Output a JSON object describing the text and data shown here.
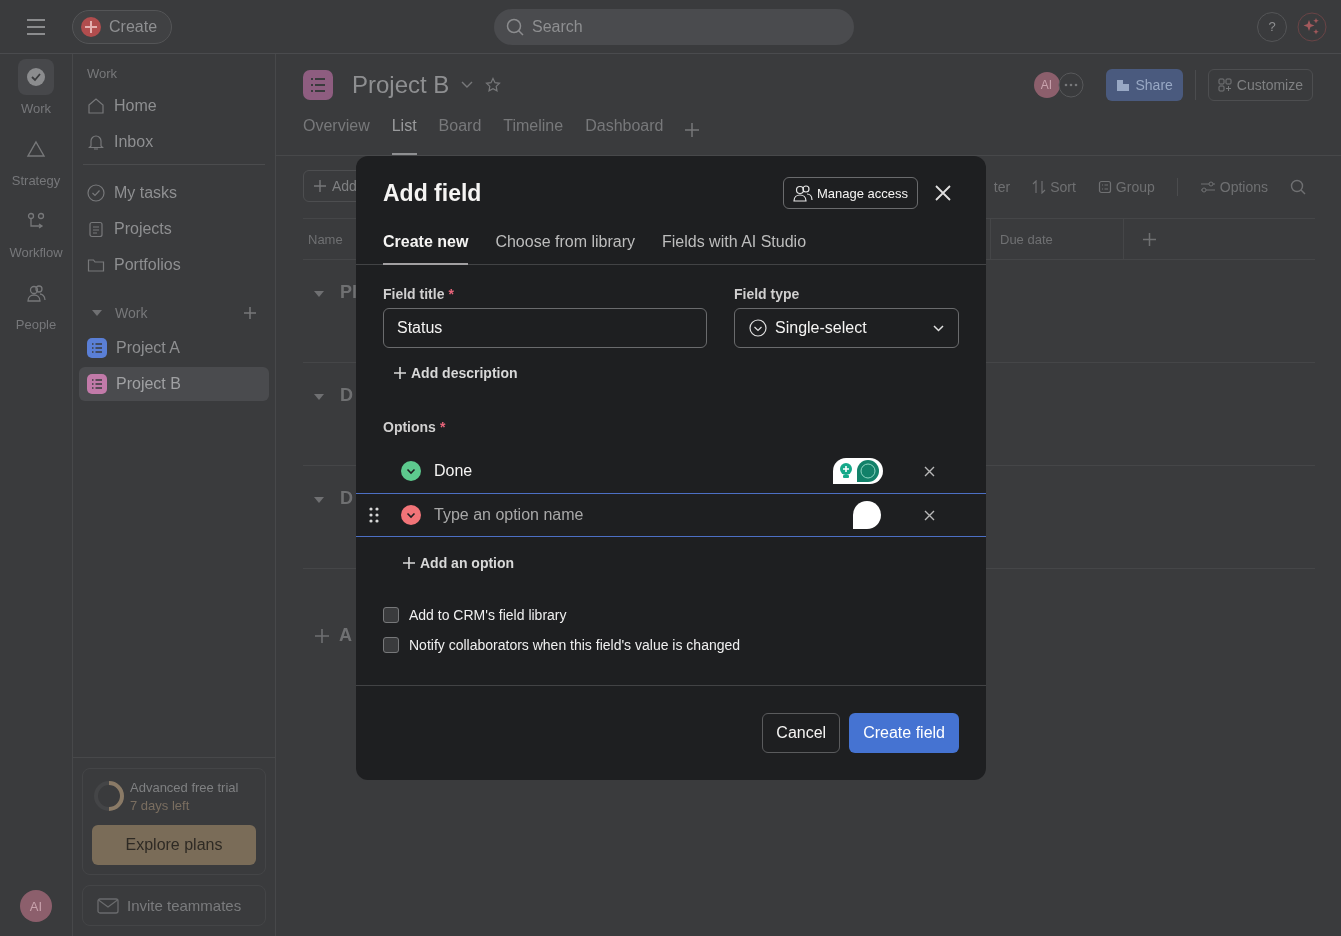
{
  "top_bar": {
    "create_label": "Create",
    "search": {
      "placeholder": "Search"
    },
    "help": "?"
  },
  "rail": [
    {
      "label": "Work",
      "selected": true
    },
    {
      "label": "Strategy",
      "selected": false
    },
    {
      "label": "Workflow",
      "selected": false
    },
    {
      "label": "People",
      "selected": false
    }
  ],
  "user_avatar": "AI",
  "sidebar": {
    "section_label": "Work",
    "nav": [
      {
        "label": "Home"
      },
      {
        "label": "Inbox"
      }
    ],
    "nav2": [
      {
        "label": "My tasks"
      },
      {
        "label": "Projects"
      },
      {
        "label": "Portfolios"
      }
    ],
    "team": {
      "label": "Work",
      "expanded": true,
      "projects": [
        {
          "label": "Project A",
          "color": "#5a7fd6",
          "selected": false
        },
        {
          "label": "Project B",
          "color": "#c27aa9",
          "selected": true
        }
      ]
    },
    "trial": {
      "title": "Advanced free trial",
      "subtitle": "7 days left",
      "level": 0.5,
      "button": "Explore plans"
    },
    "invite": "Invite teammates"
  },
  "project": {
    "title": "Project B",
    "avatar": "AI",
    "share": "Share",
    "customize": "Customize",
    "tabs": [
      {
        "label": "Overview",
        "selected": false
      },
      {
        "label": "List",
        "selected": true
      },
      {
        "label": "Board",
        "selected": false
      },
      {
        "label": "Timeline",
        "selected": false
      },
      {
        "label": "Dashboard",
        "selected": false
      }
    ]
  },
  "toolbar": {
    "add": "Add",
    "right": [
      "ter",
      "Sort",
      "Group",
      "Options"
    ]
  },
  "table": {
    "columns": [
      "Name",
      "Due date"
    ],
    "groups": [
      "Pl",
      "D",
      "D"
    ],
    "add_section": "A"
  },
  "modal": {
    "title": "Add field",
    "manage_access": "Manage access",
    "tabs": [
      {
        "label": "Create new",
        "selected": true
      },
      {
        "label": "Choose from library",
        "selected": false
      },
      {
        "label": "Fields with AI Studio",
        "selected": false
      }
    ],
    "field_title": {
      "label": "Field title",
      "required_mark": "*",
      "value": "Status"
    },
    "field_type": {
      "label": "Field type",
      "value": "Single-select"
    },
    "add_description": "Add description",
    "options_label": "Options",
    "options_required_mark": "*",
    "options": [
      {
        "value": "Done",
        "color": "#5dca8e",
        "focused": false
      },
      {
        "placeholder": "Type an option name",
        "color": "#f27478",
        "focused": true
      }
    ],
    "add_option": "Add an option",
    "checkboxes": [
      {
        "label": "Add to CRM's field library",
        "checked": false
      },
      {
        "label": "Notify collaborators when this field's value is changed",
        "checked": false
      }
    ],
    "cancel": "Cancel",
    "create": "Create field"
  }
}
